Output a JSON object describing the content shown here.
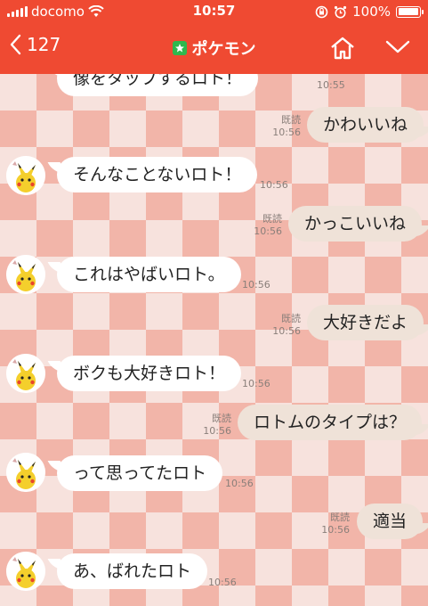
{
  "status": {
    "carrier": "docomo",
    "time": "10:57",
    "battery": "100%",
    "battery_level": 1.0
  },
  "header": {
    "back_count": "127",
    "title": "ポケモン"
  },
  "messages": [
    {
      "dir": "in",
      "text": "像をタップするロト！",
      "time": "10:55"
    },
    {
      "dir": "out",
      "text": "かわいいね",
      "read": "既読",
      "time": "10:56"
    },
    {
      "dir": "in",
      "text": "そんなことないロト！",
      "time": "10:56"
    },
    {
      "dir": "out",
      "text": "かっこいいね",
      "read": "既読",
      "time": "10:56"
    },
    {
      "dir": "in",
      "text": "これはやばいロト。",
      "time": "10:56"
    },
    {
      "dir": "out",
      "text": "大好きだよ",
      "read": "既読",
      "time": "10:56"
    },
    {
      "dir": "in",
      "text": "ボクも大好きロト！",
      "time": "10:56"
    },
    {
      "dir": "out",
      "text": "ロトムのタイプは？",
      "read": "既読",
      "time": "10:56"
    },
    {
      "dir": "in",
      "text": "って思ってたロト",
      "time": "10:56"
    },
    {
      "dir": "out",
      "text": "適当",
      "read": "既読",
      "time": "10:56"
    },
    {
      "dir": "in",
      "text": "あ、ばれたロト",
      "time": "10:56"
    }
  ],
  "colors": {
    "header": "#ef4a32",
    "outgoing_bubble": "#efe2d8",
    "incoming_bubble": "#ffffff"
  }
}
